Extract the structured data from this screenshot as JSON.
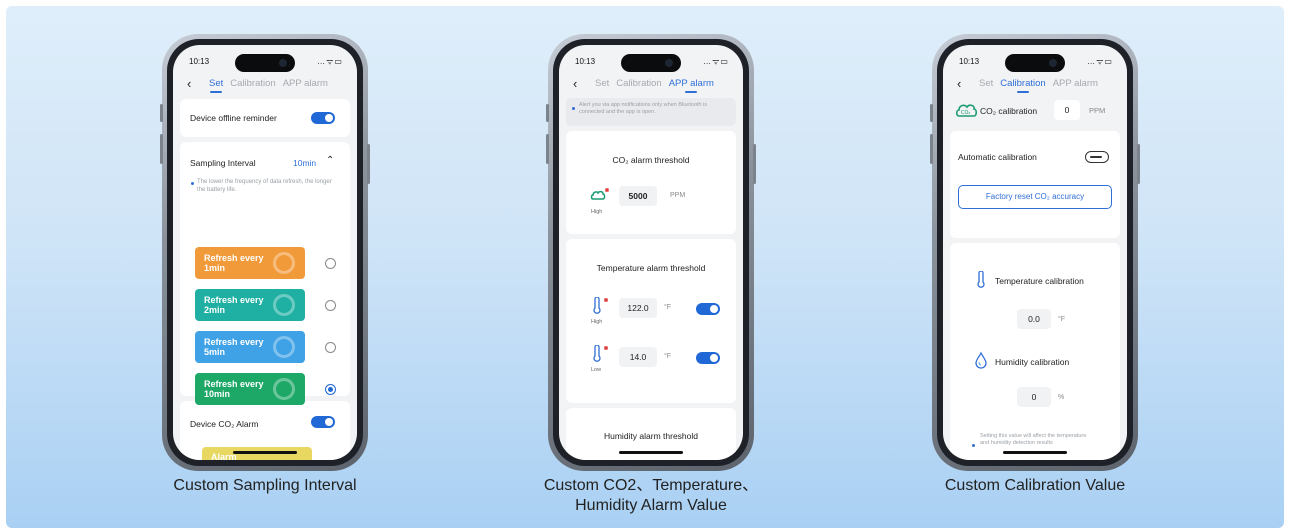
{
  "phone1": {
    "time": "10:13",
    "tabs": {
      "set": "Set",
      "calibration": "Calibration",
      "app_alarm": "APP alarm"
    },
    "offline_reminder": "Device offline reminder",
    "sampling_interval": "Sampling Interval",
    "sampling_value": "10min",
    "sampling_hint": "The lower the frequency of data refresh, the longer the battery life.",
    "options": [
      {
        "line1": "Refresh every",
        "line2": "1min",
        "color": "#f19a3a",
        "selected": false
      },
      {
        "line1": "Refresh every",
        "line2": "2min",
        "color": "#1fb0a3",
        "selected": false
      },
      {
        "line1": "Refresh every",
        "line2": "5min",
        "color": "#3fa2e6",
        "selected": false
      },
      {
        "line1": "Refresh every",
        "line2": "10min",
        "color": "#1ea867",
        "selected": true
      }
    ],
    "co2_alarm": "Device CO₂ Alarm",
    "alarm_partial": "Alarm",
    "caption": "Custom Sampling Interval"
  },
  "phone2": {
    "time": "10:13",
    "tabs": {
      "set": "Set",
      "calibration": "Calibration",
      "app_alarm": "APP alarm"
    },
    "notice": "Alert you via app notifications only when Bluetooth is connected and the app is open.",
    "co2_title": "CO₂ alarm threshold",
    "co2_value": "5000",
    "co2_unit": "PPM",
    "high": "High",
    "low": "Low",
    "temp_title": "Temperature alarm threshold",
    "temp_high": "122.0",
    "temp_low": "14.0",
    "temp_unit": "°F",
    "humidity_title": "Humidity alarm threshold",
    "caption_line1": "Custom CO2、Temperature、",
    "caption_line2": "Humidity Alarm Value"
  },
  "phone3": {
    "time": "10:13",
    "tabs": {
      "set": "Set",
      "calibration": "Calibration",
      "app_alarm": "APP alarm"
    },
    "co2_cal": "CO₂ calibration",
    "co2_cal_value": "0",
    "co2_cal_unit": "PPM",
    "auto_cal": "Automatic calibration",
    "factory_reset": "Factory reset CO₂ accuracy",
    "temp_cal": "Temperature calibration",
    "temp_cal_value": "0.0",
    "temp_cal_unit": "°F",
    "hum_cal": "Humidity calibration",
    "hum_cal_value": "0",
    "hum_cal_unit": "%",
    "cal_hint": "Setting this value will affect the temperature and humidity detection results",
    "caption": "Custom Calibration Value"
  },
  "colors": {
    "accent": "#1f68d6",
    "tab_active": "#2f6fd6",
    "background_top": "#dfeefa",
    "background_bottom": "#a9d0f3"
  }
}
